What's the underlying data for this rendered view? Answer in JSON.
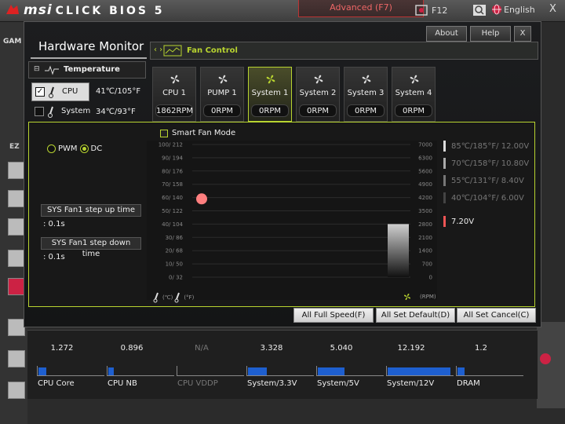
{
  "bios": {
    "brand": "msi",
    "product": "CLICK BIOS 5",
    "mode_tab": "Advanced (F7)",
    "f12_label": "F12",
    "language": "English",
    "sidebar_game_label": "GAM",
    "sidebar_ez_label": "EZ",
    "close_glyph": "X"
  },
  "dialog": {
    "title": "Hardware Monitor",
    "buttons": {
      "about": "About",
      "help": "Help",
      "close": "X"
    },
    "section": "Fan Control"
  },
  "temperature": {
    "header": "Temperature",
    "expand_glyph": "⊟",
    "sensors": [
      {
        "name": "CPU",
        "value": "41℃/105°F",
        "checked": true
      },
      {
        "name": "System",
        "value": "34℃/93°F",
        "checked": false
      }
    ]
  },
  "fans": [
    {
      "name": "CPU 1",
      "rpm": "1862RPM",
      "active": false
    },
    {
      "name": "PUMP 1",
      "rpm": "0RPM",
      "active": false
    },
    {
      "name": "System 1",
      "rpm": "0RPM",
      "active": true
    },
    {
      "name": "System 2",
      "rpm": "0RPM",
      "active": false
    },
    {
      "name": "System 3",
      "rpm": "0RPM",
      "active": false
    },
    {
      "name": "System 4",
      "rpm": "0RPM",
      "active": false
    }
  ],
  "control": {
    "mode_pwm": "PWM",
    "mode_dc": "DC",
    "selected_mode": "DC",
    "step_up_label": "SYS Fan1 step up time",
    "step_up_value": ": 0.1s",
    "step_down_label": "SYS Fan1 step down time",
    "step_down_value": ": 0.1s",
    "smart_fan_label": "Smart Fan Mode",
    "smart_fan_checked": false
  },
  "graph": {
    "left_ticks": [
      "100/ 212",
      "90/ 194",
      "80/ 176",
      "70/ 158",
      "60/ 140",
      "50/ 122",
      "40/ 104",
      "30/ 86",
      "20/ 68",
      "10/ 50",
      "0/ 32"
    ],
    "right_ticks": [
      "7000",
      "6300",
      "5600",
      "4900",
      "4200",
      "3500",
      "2800",
      "2100",
      "1400",
      "700",
      "0"
    ],
    "celsius_label": "(℃)",
    "fahrenheit_label": "(°F)",
    "rpm_label": "(RPM)",
    "current_temp_c": 59,
    "current_rpm": 0,
    "accent_color": "#b8d430",
    "marker_color": "#ff7f7f"
  },
  "voltage_steps": [
    {
      "label": "85℃/185°F/ 12.00V",
      "active": false
    },
    {
      "label": "70℃/158°F/ 10.80V",
      "active": false
    },
    {
      "label": "55℃/131°F/ 8.40V",
      "active": false
    },
    {
      "label": "40℃/104°F/ 6.00V",
      "active": false
    },
    {
      "label": "7.20V",
      "active": true
    }
  ],
  "actions": {
    "full_speed": "All Full Speed(F)",
    "set_default": "All Set Default(D)",
    "set_cancel": "All Set Cancel(C)"
  },
  "voltages": [
    {
      "name": "CPU Core",
      "value": "1.272",
      "level": 0.12,
      "dim": false
    },
    {
      "name": "CPU NB",
      "value": "0.896",
      "level": 0.08,
      "dim": false
    },
    {
      "name": "CPU VDDP",
      "value": "N/A",
      "level": 0,
      "dim": true
    },
    {
      "name": "System/3.3V",
      "value": "3.328",
      "level": 0.29,
      "dim": false
    },
    {
      "name": "System/5V",
      "value": "5.040",
      "level": 0.42,
      "dim": false
    },
    {
      "name": "System/12V",
      "value": "12.192",
      "level": 0.98,
      "dim": false
    },
    {
      "name": "DRAM",
      "value": "1.2",
      "level": 0.11,
      "dim": false
    }
  ]
}
